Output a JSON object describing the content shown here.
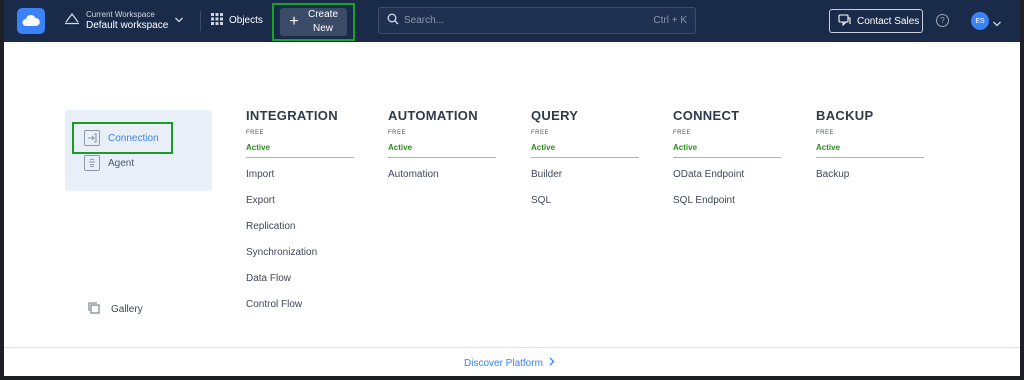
{
  "topbar": {
    "workspace_label": "Current Workspace",
    "workspace_name": "Default workspace",
    "objects_label": "Objects",
    "create_label": "Create New",
    "search_placeholder": "Search...",
    "search_shortcut": "Ctrl + K",
    "contact_label": "Contact Sales",
    "help_glyph": "?",
    "avatar_initials": "ES"
  },
  "sidebar": {
    "items": [
      {
        "label": "Connection",
        "icon": "connection-icon"
      },
      {
        "label": "Agent",
        "icon": "agent-icon"
      }
    ],
    "gallery_label": "Gallery"
  },
  "columns": [
    {
      "title": "INTEGRATION",
      "tier": "FREE",
      "status": "Active",
      "items": [
        "Import",
        "Export",
        "Replication",
        "Synchronization",
        "Data Flow",
        "Control Flow"
      ]
    },
    {
      "title": "AUTOMATION",
      "tier": "FREE",
      "status": "Active",
      "items": [
        "Automation"
      ]
    },
    {
      "title": "QUERY",
      "tier": "FREE",
      "status": "Active",
      "items": [
        "Builder",
        "SQL"
      ]
    },
    {
      "title": "CONNECT",
      "tier": "FREE",
      "status": "Active",
      "items": [
        "OData Endpoint",
        "SQL Endpoint"
      ]
    },
    {
      "title": "BACKUP",
      "tier": "FREE",
      "status": "Active",
      "items": [
        "Backup"
      ]
    }
  ],
  "footer": {
    "discover_label": "Discover Platform"
  },
  "colors": {
    "topbar": "#1a2b4a",
    "accent": "#3b82f6",
    "active_green": "#2e8b1f",
    "highlight_border": "#1a9a25"
  }
}
